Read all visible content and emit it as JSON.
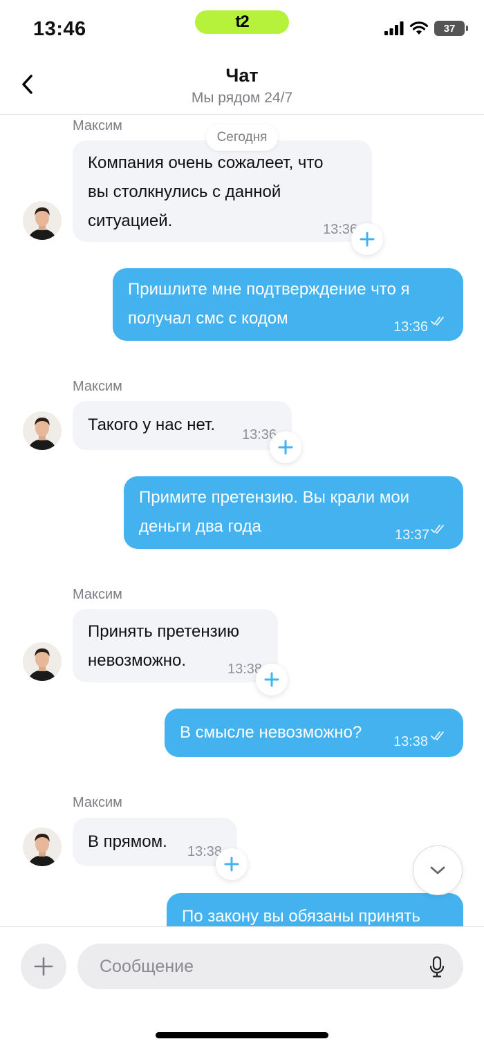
{
  "status_bar": {
    "time": "13:46",
    "carrier": "t2",
    "battery": "37"
  },
  "header": {
    "title": "Чат",
    "subtitle": "Мы рядом 24/7"
  },
  "chat": {
    "date_separator": "Сегодня",
    "messages": [
      {
        "direction": "incoming",
        "sender": "Максим",
        "lines": [
          "Компания очень сожалеет, что",
          "вы столкнулись с данной",
          "ситуацией."
        ],
        "time": "13:36"
      },
      {
        "direction": "outgoing",
        "lines": [
          "Пришлите мне подтверждение что я",
          "получал смс с кодом"
        ],
        "time": "13:36"
      },
      {
        "direction": "incoming",
        "sender": "Максим",
        "lines": [
          "Такого у нас нет."
        ],
        "time": "13:36"
      },
      {
        "direction": "outgoing",
        "lines": [
          "Примите претензию. Вы крали мои",
          "деньги два года"
        ],
        "time": "13:37"
      },
      {
        "direction": "incoming",
        "sender": "Максим",
        "lines": [
          "Принять претензию",
          "невозможно."
        ],
        "time": "13:38"
      },
      {
        "direction": "outgoing",
        "lines": [
          "В смысле невозможно?"
        ],
        "time": "13:38"
      },
      {
        "direction": "incoming",
        "sender": "Максим",
        "lines": [
          "В прямом."
        ],
        "time": "13:38"
      },
      {
        "direction": "outgoing",
        "lines": [
          "По закону вы обязаны принять"
        ],
        "time": ""
      }
    ]
  },
  "composer": {
    "placeholder": "Сообщение"
  },
  "icons": {
    "back": "chevron-left-icon",
    "reaction": "plus-icon",
    "scroll": "chevron-down-icon",
    "attach": "plus-icon",
    "voice": "microphone-icon"
  },
  "colors": {
    "outgoing_bubble": "#43b2ef",
    "incoming_bubble": "#f3f4f8",
    "carrier_brand": "#b6f23b",
    "accent_icon": "#43b2ef"
  }
}
